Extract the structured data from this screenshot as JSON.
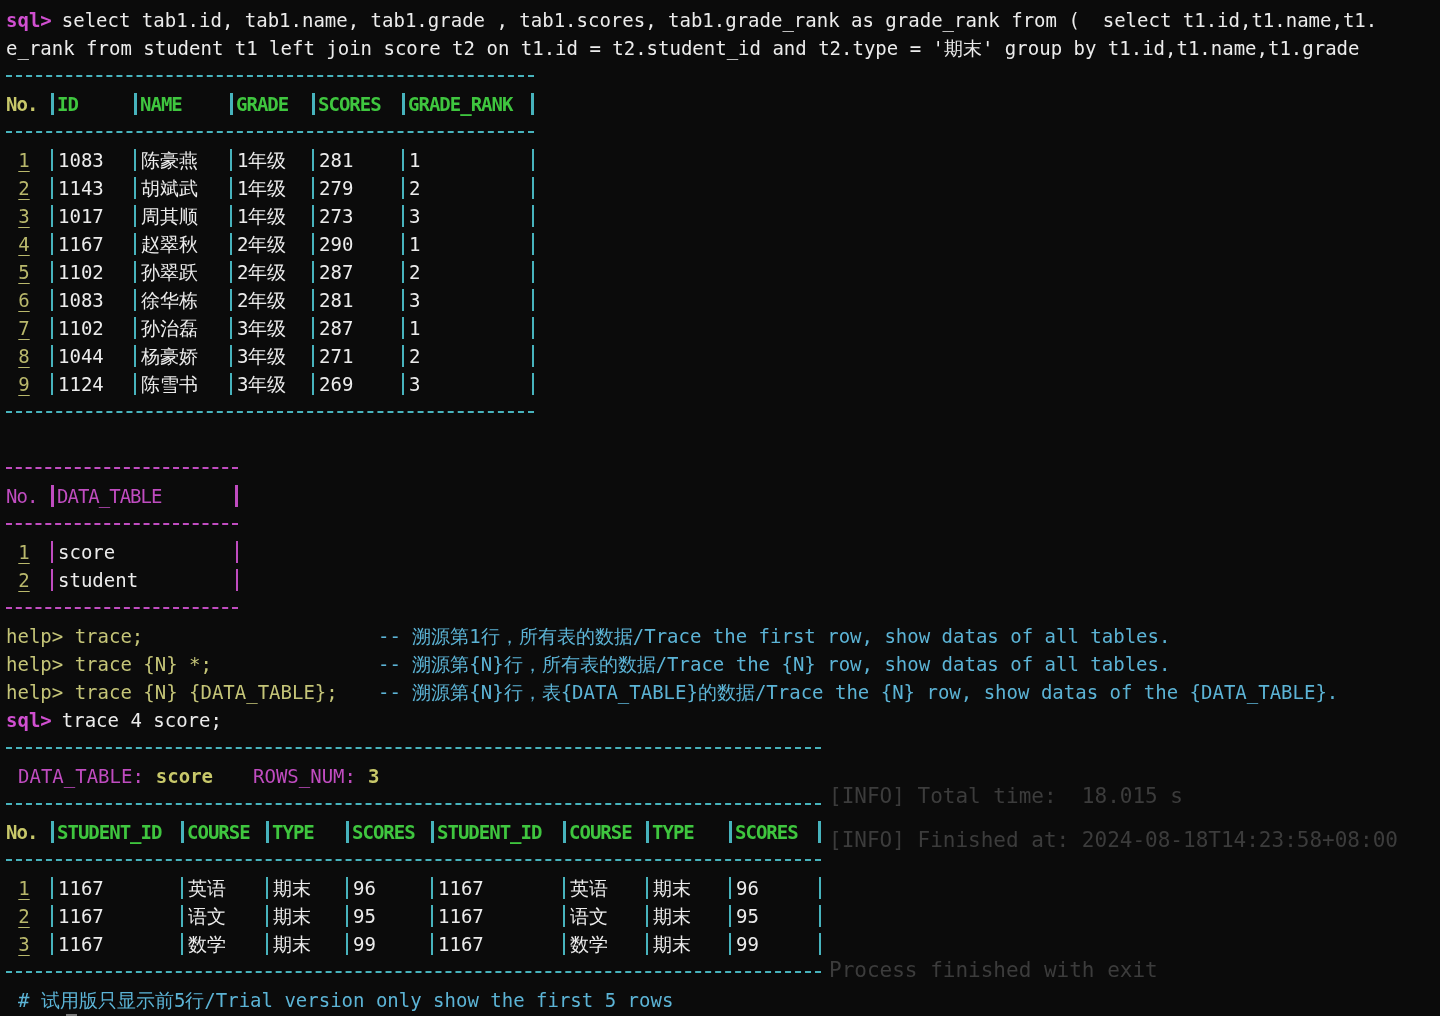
{
  "query": {
    "prompt": "sql>",
    "lines": [
      "select tab1.id, tab1.name, tab1.grade , tab1.scores, tab1.grade_rank as grade_rank from (  select t1.id,t1.name,t1.",
      "e_rank from student t1 left join score t2 on t1.id = t2.student_id and t2.type = '期末' group by t1.id,t1.name,t1.grade"
    ]
  },
  "result_table": {
    "columns": [
      "No.",
      "ID",
      "NAME",
      "GRADE",
      "SCORES",
      "GRADE_RANK"
    ],
    "rows": [
      [
        "1",
        "1083",
        "陈豪燕",
        "1年级",
        "281",
        "1"
      ],
      [
        "2",
        "1143",
        "胡斌武",
        "1年级",
        "279",
        "2"
      ],
      [
        "3",
        "1017",
        "周其顺",
        "1年级",
        "273",
        "3"
      ],
      [
        "4",
        "1167",
        "赵翠秋",
        "2年级",
        "290",
        "1"
      ],
      [
        "5",
        "1102",
        "孙翠跃",
        "2年级",
        "287",
        "2"
      ],
      [
        "6",
        "1083",
        "徐华栋",
        "2年级",
        "281",
        "3"
      ],
      [
        "7",
        "1102",
        "孙治磊",
        "3年级",
        "287",
        "1"
      ],
      [
        "8",
        "1044",
        "杨豪娇",
        "3年级",
        "271",
        "2"
      ],
      [
        "9",
        "1124",
        "陈雪书",
        "3年级",
        "269",
        "3"
      ]
    ]
  },
  "tables_table": {
    "columns": [
      "No.",
      "DATA_TABLE"
    ],
    "rows": [
      [
        "1",
        "score"
      ],
      [
        "2",
        "student"
      ]
    ]
  },
  "help": [
    {
      "prompt": "help>",
      "command": "trace;",
      "comment": "-- 溯源第1行，所有表的数据/Trace the first row, show datas of all tables."
    },
    {
      "prompt": "help>",
      "command": "trace {N} *;",
      "comment": "-- 溯源第{N}行，所有表的数据/Trace the {N} row, show datas of all tables."
    },
    {
      "prompt": "help>",
      "command": "trace {N} {DATA_TABLE};",
      "comment": "-- 溯源第{N}行，表{DATA_TABLE}的数据/Trace the {N} row, show datas of the {DATA_TABLE}."
    }
  ],
  "trace_command": {
    "prompt": "sql>",
    "command": "trace 4 score;"
  },
  "trace_result": {
    "table_label": "DATA_TABLE:",
    "table_name": "score",
    "rows_label": "ROWS_NUM:",
    "rows_num": "3",
    "columns": [
      "No.",
      "STUDENT_ID",
      "COURSE",
      "TYPE",
      "SCORES",
      "STUDENT_ID",
      "COURSE",
      "TYPE",
      "SCORES"
    ],
    "rows": [
      [
        "1",
        "1167",
        "英语",
        "期末",
        "96",
        "1167",
        "英语",
        "期末",
        "96"
      ],
      [
        "2",
        "1167",
        "语文",
        "期末",
        "95",
        "1167",
        "语文",
        "期末",
        "95"
      ],
      [
        "3",
        "1167",
        "数学",
        "期末",
        "99",
        "1167",
        "数学",
        "期末",
        "99"
      ]
    ]
  },
  "notice": "# 试用版只显示前5行/Trial version only show the first 5 rows",
  "background_log": [
    "[INFO] Total time:  18.015 s",
    "[INFO] Finished at: 2024-08-18T14:23:58+08:00",
    "Process finished with exit"
  ]
}
